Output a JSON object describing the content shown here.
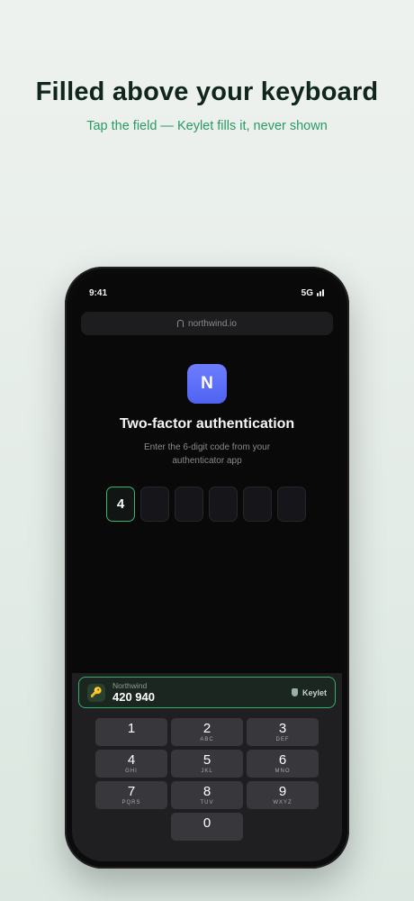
{
  "headline": "Filled above your keyboard",
  "subline": "Tap the field — Keylet fills it, never shown",
  "status": {
    "time": "9:41",
    "network": "5G"
  },
  "browser": {
    "url": "northwind.io"
  },
  "page": {
    "logo_letter": "N",
    "title": "Two-factor authentication",
    "description": "Enter the 6-digit code from your authenticator app",
    "code_digits": [
      "4",
      "",
      "",
      "",
      "",
      ""
    ]
  },
  "autofill": {
    "site": "Northwind",
    "code": "420 940",
    "brand": "Keylet"
  },
  "keypad": {
    "keys": [
      {
        "num": "1",
        "letters": ""
      },
      {
        "num": "2",
        "letters": "ABC"
      },
      {
        "num": "3",
        "letters": "DEF"
      },
      {
        "num": "4",
        "letters": "GHI"
      },
      {
        "num": "5",
        "letters": "JKL"
      },
      {
        "num": "6",
        "letters": "MNO"
      },
      {
        "num": "7",
        "letters": "PQRS"
      },
      {
        "num": "8",
        "letters": "TUV"
      },
      {
        "num": "9",
        "letters": "WXYZ"
      },
      {
        "num": "0",
        "letters": ""
      }
    ]
  },
  "colors": {
    "accent": "#35b56e",
    "logo": "#5b6cf7"
  }
}
